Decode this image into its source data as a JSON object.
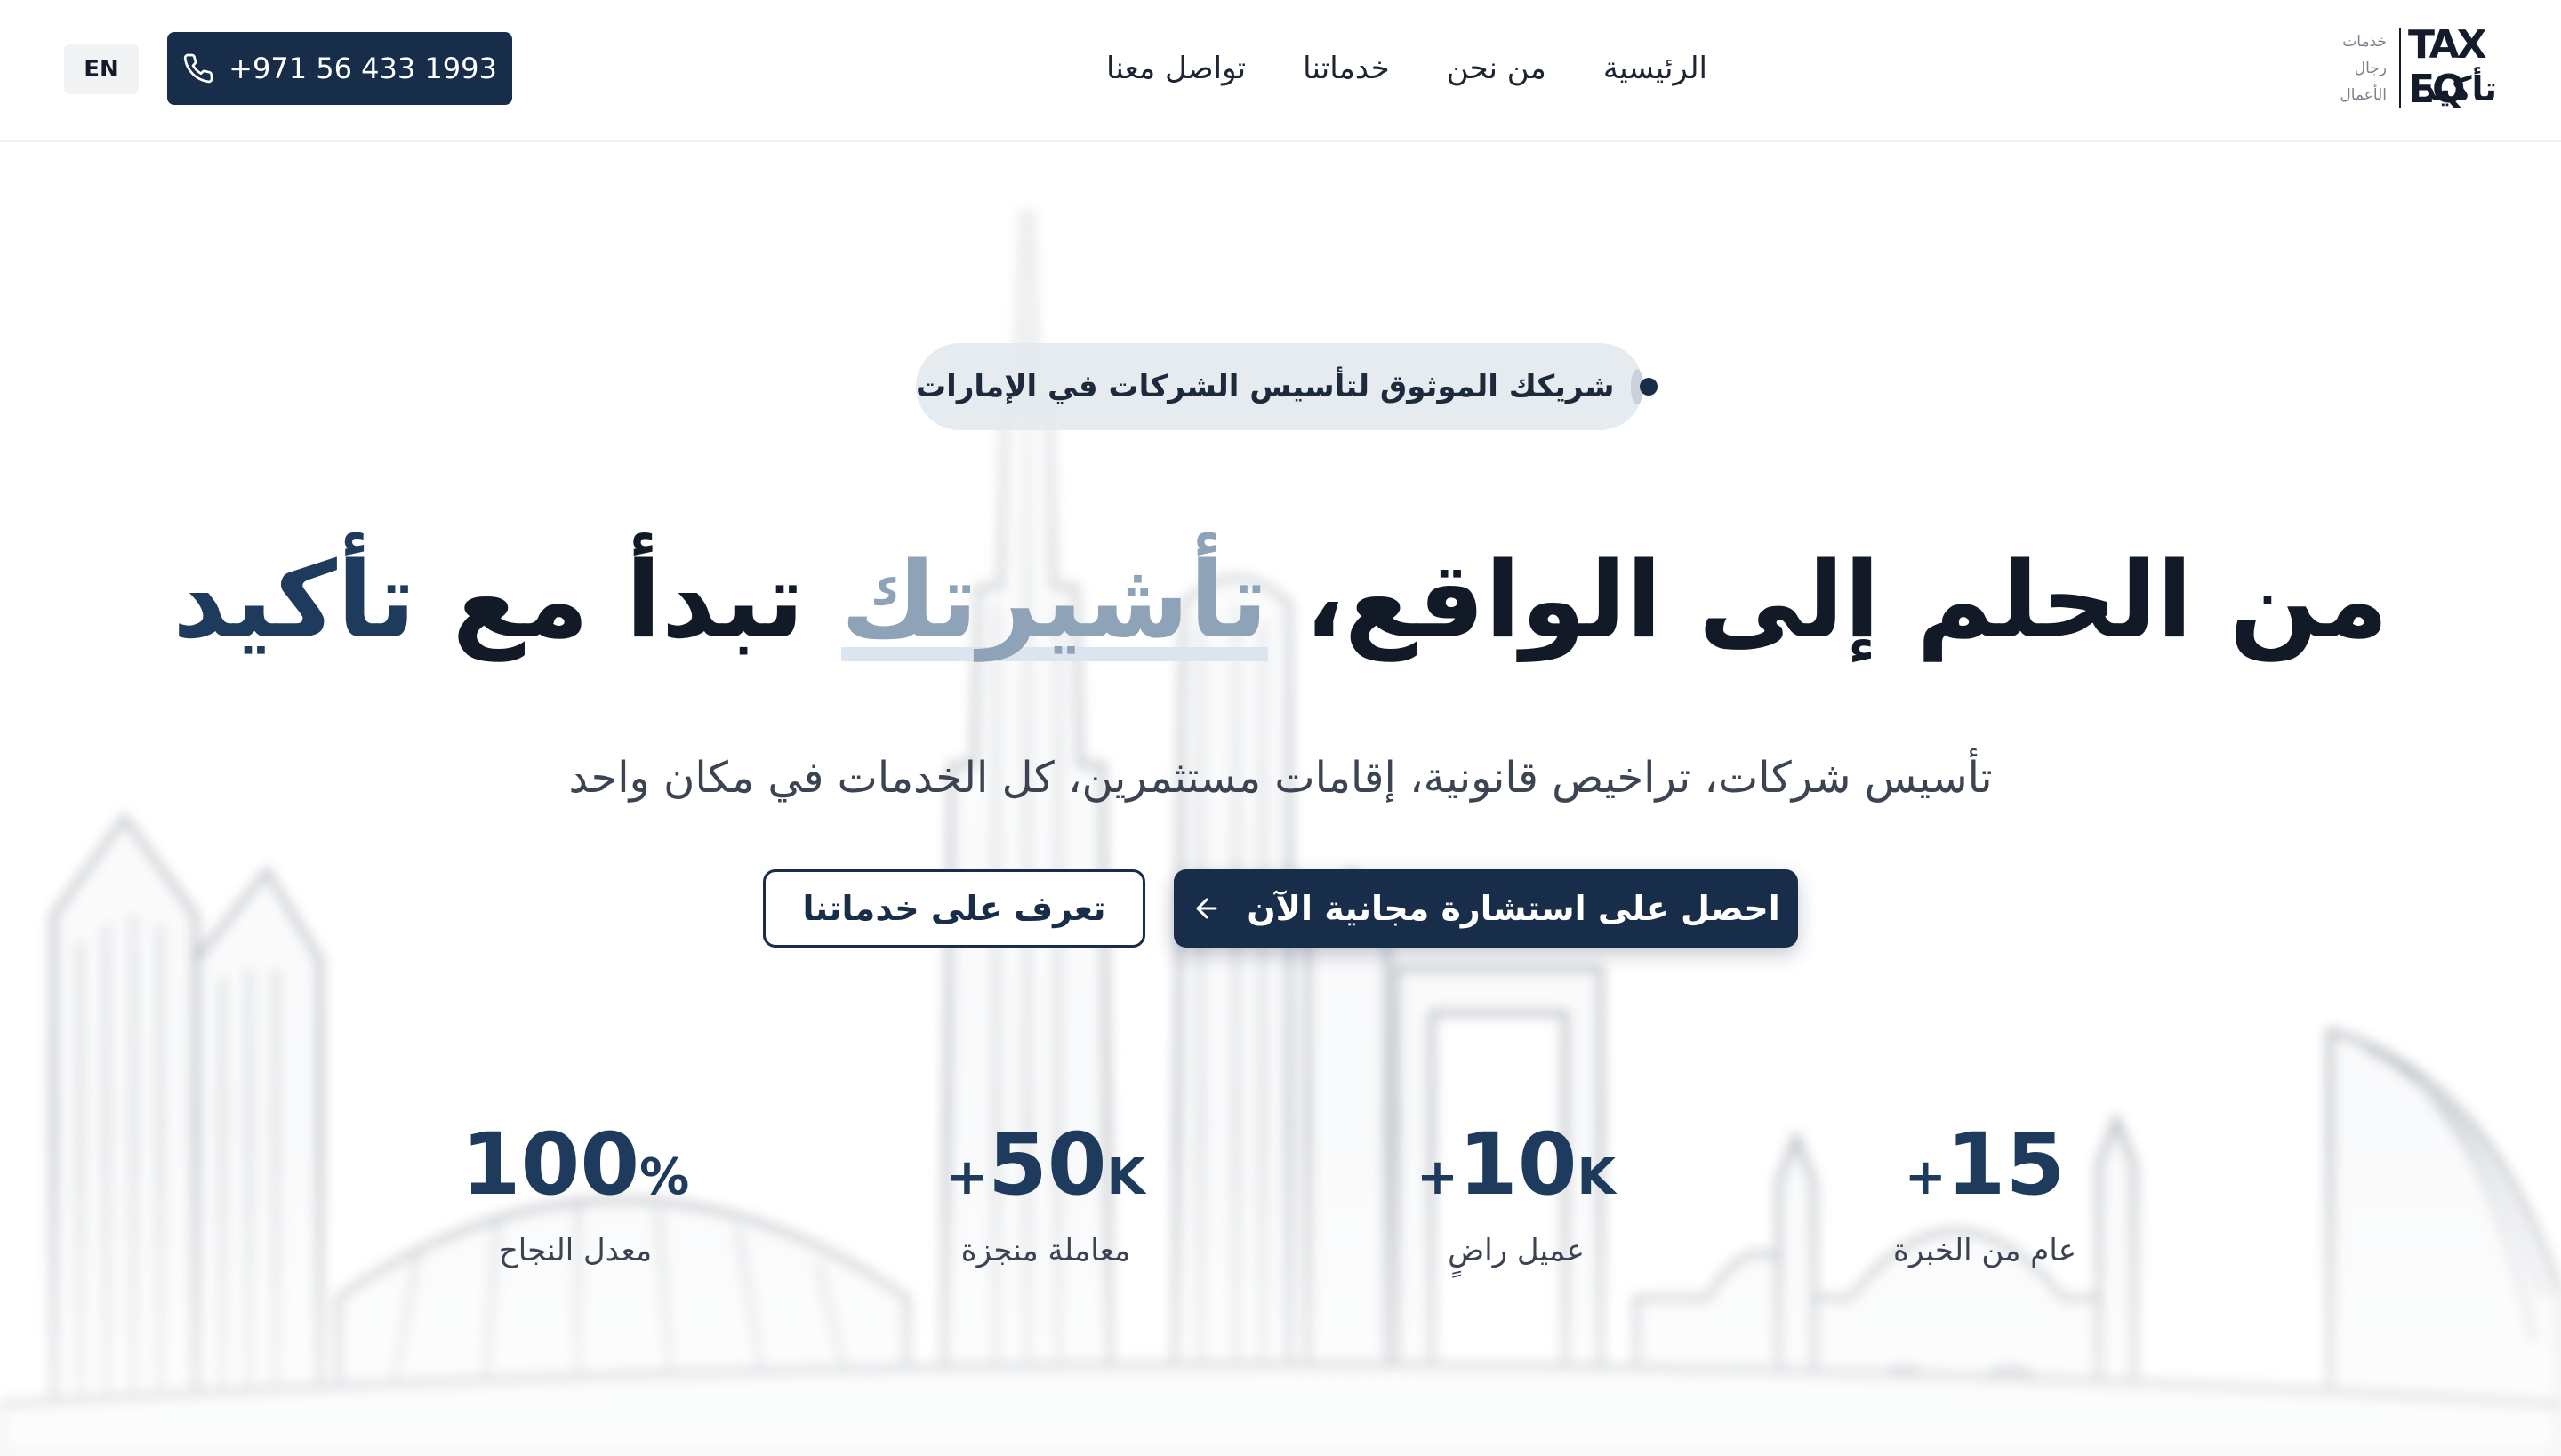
{
  "brand": {
    "logo_latin": "TAX EQ",
    "logo_arabic": "تأكيد",
    "tagline": [
      "خدمات",
      "رجال",
      "الأعمال"
    ]
  },
  "nav": {
    "items": [
      {
        "label": "الرئيسية"
      },
      {
        "label": "من نحن"
      },
      {
        "label": "خدماتنا"
      },
      {
        "label": "تواصل معنا"
      }
    ]
  },
  "header": {
    "phone": "+971 56 433 1993",
    "lang_label": "EN"
  },
  "hero": {
    "badge": "شريكك الموثوق لتأسيس الشركات في الإمارات",
    "headline_part1": "من الحلم إلى الواقع، ",
    "headline_highlight": "تأشيرتك",
    "headline_part2": " تبدأ مع ",
    "headline_brand": "تأكيد",
    "subtitle": "تأسيس شركات، تراخيص قانونية، إقامات مستثمرين، كل الخدمات في مكان واحد",
    "cta_primary": "احصل على استشارة مجانية الآن",
    "cta_secondary": "تعرف على خدماتنا"
  },
  "stats": [
    {
      "prefix": "+",
      "number": "15",
      "suffix": "",
      "label": "عام من الخبرة"
    },
    {
      "prefix": "+",
      "number": "10",
      "suffix": "K",
      "label": "عميل راضٍ"
    },
    {
      "prefix": "+",
      "number": "50",
      "suffix": "K",
      "label": "معاملة منجزة"
    },
    {
      "prefix": "",
      "number": "100",
      "suffix": "%",
      "label": "معدل النجاح"
    }
  ],
  "colors": {
    "primary": "#172d49",
    "accent_dark": "#1e3a5c",
    "accent_light": "#8fa3b8"
  },
  "icons": {
    "phone": "phone-icon",
    "cta_arrow": "arrow-left-icon",
    "badge_dot": "badge-dot-icon",
    "skyline": "dubai-skyline-illustration"
  }
}
